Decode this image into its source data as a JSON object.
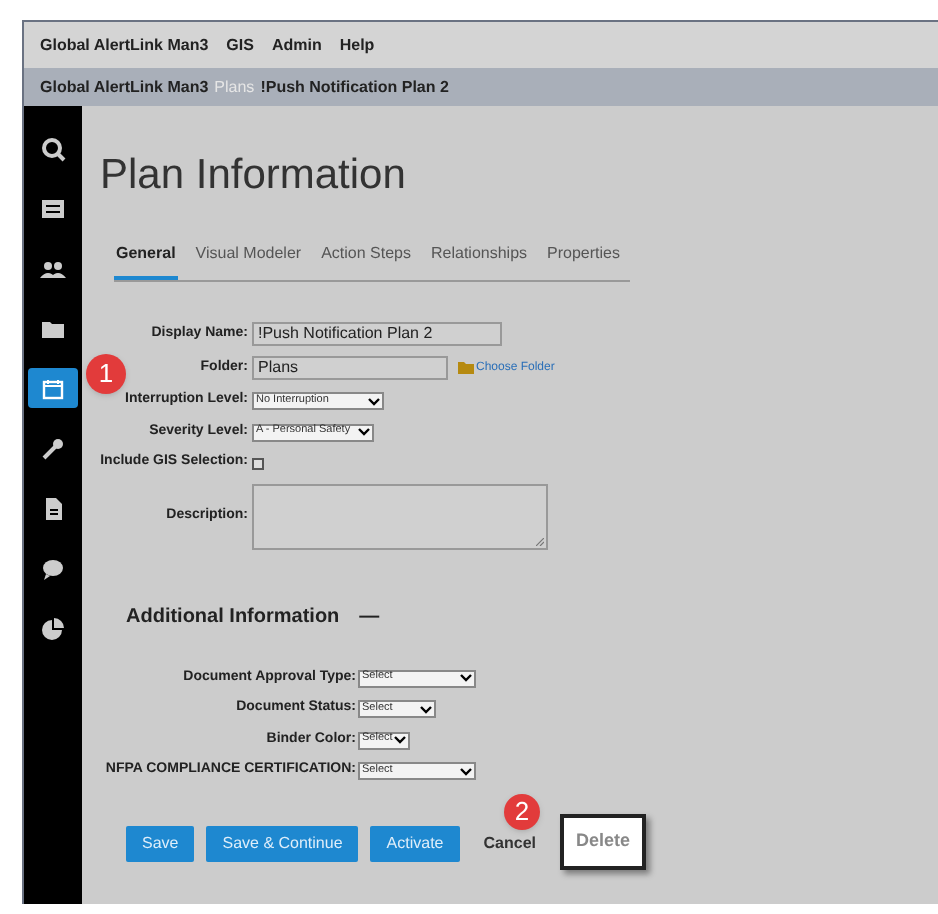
{
  "menu": [
    "Global AlertLink Man3",
    "GIS",
    "Admin",
    "Help"
  ],
  "breadcrumb": [
    "Global AlertLink Man3",
    "Plans",
    "!Push Notification Plan 2"
  ],
  "sidebar": [
    {
      "selected": false
    },
    {
      "selected": false
    },
    {
      "selected": false
    },
    {
      "selected": false
    },
    {
      "selected": true
    },
    {
      "selected": false
    },
    {
      "selected": false
    },
    {
      "selected": false
    },
    {
      "selected": false
    }
  ],
  "title": "Plan Information",
  "tabs": [
    {
      "label": "General",
      "selected": true
    },
    {
      "label": "Visual Modeler",
      "selected": false
    },
    {
      "label": "Action Steps",
      "selected": false
    },
    {
      "label": "Relationships",
      "selected": false
    },
    {
      "label": "Properties",
      "selected": false
    }
  ],
  "fields": [
    {
      "kind": "text",
      "label": "Display Name:",
      "value": "!Push Notification Plan 2"
    },
    {
      "kind": "folder",
      "label": "Folder:",
      "value": "Plans",
      "link": "Choose Folder"
    },
    {
      "kind": "select",
      "label": "Interruption Level:",
      "value": "No Interruption"
    },
    {
      "kind": "select",
      "label": "Severity Level:",
      "value": "A - Personal Safety"
    },
    {
      "kind": "checkbox",
      "label": "Include GIS Selection:",
      "checked": false
    },
    {
      "kind": "textarea",
      "label": "Description:"
    }
  ],
  "additional": {
    "heading": "Additional Information",
    "expanded": true,
    "toggle": "—",
    "fields": [
      {
        "label": "Document Approval Type:",
        "value": "Select"
      },
      {
        "label": "Document Status:",
        "value": "Select"
      },
      {
        "label": "Binder Color:",
        "value": "Select"
      },
      {
        "label": "NFPA COMPLIANCE CERTIFICATION:",
        "value": "Select"
      }
    ]
  },
  "buttons": [
    {
      "kind": "primary",
      "label": "Save"
    },
    {
      "kind": "primary",
      "label": "Save & Continue"
    },
    {
      "kind": "primary",
      "label": "Activate"
    },
    {
      "kind": "plain",
      "label": "Cancel"
    },
    {
      "kind": "highlighted",
      "label": "Delete"
    }
  ],
  "callouts": [
    "1",
    "2"
  ]
}
